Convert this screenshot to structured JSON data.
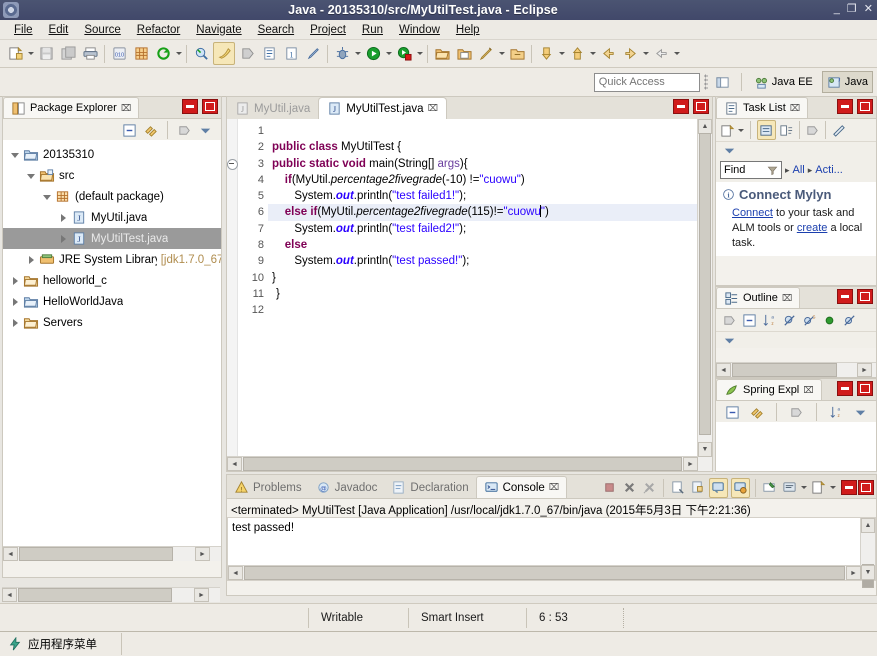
{
  "window": {
    "title": "Java - 20135310/src/MyUtilTest.java - Eclipse",
    "minimize_label": "_",
    "restore_label": "❐",
    "close_label": "✕",
    "app_icon": "eclipse-icon"
  },
  "menu": [
    {
      "label": "File"
    },
    {
      "label": "Edit"
    },
    {
      "label": "Source"
    },
    {
      "label": "Refactor"
    },
    {
      "label": "Navigate"
    },
    {
      "label": "Search"
    },
    {
      "label": "Project"
    },
    {
      "label": "Run"
    },
    {
      "label": "Window"
    },
    {
      "label": "Help"
    }
  ],
  "toolbar": {
    "items": [
      {
        "name": "new-wizard-icon",
        "glyph": "new"
      },
      {
        "name": "new-dropdown-caret",
        "glyph": "caret"
      },
      {
        "name": "save-icon",
        "glyph": "save"
      },
      {
        "name": "save-all-icon",
        "glyph": "saveall"
      },
      {
        "name": "print-icon",
        "glyph": "print"
      },
      {
        "name": "sep",
        "glyph": "sep"
      },
      {
        "name": "build-all-icon",
        "glyph": "build"
      },
      {
        "name": "new-java-package-icon",
        "glyph": "package"
      },
      {
        "name": "refresh-icon",
        "glyph": "refresh"
      },
      {
        "name": "refresh-caret",
        "glyph": "caret"
      },
      {
        "name": "sep",
        "glyph": "sep"
      },
      {
        "name": "open-type-icon",
        "glyph": "opentype"
      },
      {
        "name": "toggle-mark-occurrences-icon",
        "glyph": "marker"
      },
      {
        "name": "skip-breakpoints-icon",
        "glyph": "skipbp"
      },
      {
        "name": "new-java-class-icon",
        "glyph": "javaclass"
      },
      {
        "name": "new-java-interface-icon",
        "glyph": "javainterface"
      },
      {
        "name": "annotation-icon",
        "glyph": "pen"
      },
      {
        "name": "sep",
        "glyph": "sep"
      },
      {
        "name": "debug-icon",
        "glyph": "debug"
      },
      {
        "name": "debug-caret",
        "glyph": "caret"
      },
      {
        "name": "run-icon",
        "glyph": "run"
      },
      {
        "name": "run-caret",
        "glyph": "caret"
      },
      {
        "name": "run-external-tools-icon",
        "glyph": "externaltools"
      },
      {
        "name": "external-tools-caret",
        "glyph": "caret"
      },
      {
        "name": "sep",
        "glyph": "sep"
      },
      {
        "name": "open-resource-icon",
        "glyph": "folder1"
      },
      {
        "name": "open-folder-icon",
        "glyph": "folder2"
      },
      {
        "name": "search-icon",
        "glyph": "pencil"
      },
      {
        "name": "search-caret",
        "glyph": "caret"
      },
      {
        "name": "open-task-icon",
        "glyph": "folder3"
      },
      {
        "name": "sep",
        "glyph": "sep"
      },
      {
        "name": "next-annotation-icon",
        "glyph": "downarrow"
      },
      {
        "name": "next-caret",
        "glyph": "caret"
      },
      {
        "name": "previous-annotation-icon",
        "glyph": "uparrow"
      },
      {
        "name": "prev-caret",
        "glyph": "caret"
      },
      {
        "name": "back-icon",
        "glyph": "back"
      },
      {
        "name": "forward-icon",
        "glyph": "forward"
      },
      {
        "name": "nav-caret",
        "glyph": "caret"
      },
      {
        "name": "last-edit-icon",
        "glyph": "lastedit"
      },
      {
        "name": "lastedit-caret",
        "glyph": "caret"
      }
    ]
  },
  "quick_access": {
    "placeholder": "Quick Access",
    "open_perspective_icon": "open-perspective-icon",
    "perspectives": [
      {
        "label": "Java EE",
        "active": false,
        "icon": "javaee-perspective-icon"
      },
      {
        "label": "Java",
        "active": true,
        "icon": "java-perspective-icon"
      }
    ]
  },
  "package_explorer": {
    "title": "Package Explorer",
    "close_glyph": "⌧",
    "toolbar": [
      {
        "name": "collapse-all-icon"
      },
      {
        "name": "link-with-editor-icon"
      },
      {
        "name": "focus-on-active-task-icon"
      },
      {
        "name": "view-menu-icon"
      }
    ],
    "tree": [
      {
        "label": "20135310",
        "indent": 0,
        "arrow": "open",
        "icon": "project-icon",
        "selected": false
      },
      {
        "label": "src",
        "indent": 1,
        "arrow": "open",
        "icon": "source-folder-icon",
        "selected": false
      },
      {
        "label": "(default package)",
        "indent": 2,
        "arrow": "open",
        "icon": "package-icon",
        "selected": false
      },
      {
        "label": "MyUtil.java",
        "indent": 3,
        "arrow": "closed",
        "icon": "java-file-icon",
        "selected": false
      },
      {
        "label": "MyUtilTest.java",
        "indent": 3,
        "arrow": "closed",
        "icon": "java-file-icon",
        "selected": true
      },
      {
        "label": "JRE System Library",
        "suffix": "[jdk1.7.0_67",
        "indent": 2,
        "arrow": "closed",
        "icon": "library-icon",
        "selected": false
      },
      {
        "label": "helloworld_c",
        "indent": 0,
        "arrow": "closed",
        "icon": "folder-project-icon",
        "selected": false
      },
      {
        "label": "HelloWorldJava",
        "indent": 0,
        "arrow": "closed",
        "icon": "project-closed-icon",
        "selected": false
      },
      {
        "label": "Servers",
        "indent": 0,
        "arrow": "closed",
        "icon": "folder-project-icon",
        "selected": false
      }
    ]
  },
  "editor": {
    "tabs": [
      {
        "label": "MyUtil.java",
        "active": false,
        "icon": "java-file-icon"
      },
      {
        "label": "MyUtilTest.java",
        "active": true,
        "icon": "java-file-icon",
        "close_glyph": "⌧"
      }
    ],
    "lines": [
      {
        "n": "1",
        "fold": false,
        "cur": false,
        "tokens": []
      },
      {
        "n": "2",
        "fold": false,
        "cur": false,
        "tokens": [
          {
            "t": "kw",
            "v": "public class "
          },
          {
            "t": "p",
            "v": "MyUtilTest {"
          }
        ]
      },
      {
        "n": "3",
        "fold": true,
        "cur": false,
        "tokens": [
          {
            "t": "kw",
            "v": "public static void "
          },
          {
            "t": "p",
            "v": "main(String[] "
          },
          {
            "t": "prm",
            "v": "args"
          },
          {
            "t": "p",
            "v": "){"
          }
        ]
      },
      {
        "n": "4",
        "fold": false,
        "cur": false,
        "tokens": [
          {
            "t": "p",
            "v": "    "
          },
          {
            "t": "kw",
            "v": "if"
          },
          {
            "t": "p",
            "v": "(MyUtil."
          },
          {
            "t": "stm",
            "v": "percentage2fivegrade"
          },
          {
            "t": "p",
            "v": "(-10) !="
          },
          {
            "t": "str",
            "v": "\"cuowu\""
          },
          {
            "t": "p",
            "v": ")"
          }
        ]
      },
      {
        "n": "5",
        "fold": false,
        "cur": false,
        "tokens": [
          {
            "t": "p",
            "v": "       System."
          },
          {
            "t": "fld",
            "v": "out"
          },
          {
            "t": "p",
            "v": ".println("
          },
          {
            "t": "str",
            "v": "\"test failed1!\""
          },
          {
            "t": "p",
            "v": ");"
          }
        ]
      },
      {
        "n": "6",
        "fold": false,
        "cur": true,
        "tokens": [
          {
            "t": "p",
            "v": "    "
          },
          {
            "t": "kw",
            "v": "else if"
          },
          {
            "t": "p",
            "v": "(MyUtil."
          },
          {
            "t": "stm",
            "v": "percentage2fivegrade"
          },
          {
            "t": "p",
            "v": "(115)!="
          },
          {
            "t": "str",
            "v": "\"cuowu"
          },
          {
            "t": "caret",
            "v": ""
          },
          {
            "t": "str",
            "v": "\""
          },
          {
            "t": "p",
            "v": ")"
          }
        ]
      },
      {
        "n": "7",
        "fold": false,
        "cur": false,
        "tokens": [
          {
            "t": "p",
            "v": "       System."
          },
          {
            "t": "fld",
            "v": "out"
          },
          {
            "t": "p",
            "v": ".println("
          },
          {
            "t": "str",
            "v": "\"test failed2!\""
          },
          {
            "t": "p",
            "v": ");"
          }
        ]
      },
      {
        "n": "8",
        "fold": false,
        "cur": false,
        "tokens": [
          {
            "t": "p",
            "v": "    "
          },
          {
            "t": "kw",
            "v": "else"
          }
        ]
      },
      {
        "n": "9",
        "fold": false,
        "cur": false,
        "tokens": [
          {
            "t": "p",
            "v": "       System."
          },
          {
            "t": "fld",
            "v": "out"
          },
          {
            "t": "p",
            "v": ".println("
          },
          {
            "t": "str",
            "v": "\"test passed!\""
          },
          {
            "t": "p",
            "v": ");"
          }
        ]
      },
      {
        "n": "10",
        "fold": false,
        "cur": false,
        "tokens": [
          {
            "t": "p",
            "v": "}"
          }
        ]
      },
      {
        "n": "11",
        "fold": false,
        "cur": false,
        "tokens": [
          {
            "t": "p",
            "v": "}"
          }
        ]
      },
      {
        "n": "12",
        "fold": false,
        "cur": false,
        "tokens": []
      }
    ]
  },
  "task_list": {
    "title": "Task List",
    "close_glyph": "⌧",
    "toolbar": [
      {
        "name": "new-task-icon"
      },
      {
        "name": "new-task-caret"
      },
      {
        "name": "categorized-presentation-icon"
      },
      {
        "name": "scheduled-presentation-icon"
      },
      {
        "name": "focus-on-workweek-icon"
      },
      {
        "name": "synchronize-changed-icon"
      },
      {
        "name": "view-menu-icon"
      }
    ],
    "find_placeholder": "Find",
    "find_icon": "filter-icon",
    "filters": [
      {
        "label": "All"
      },
      {
        "label": "Acti..."
      }
    ],
    "mylyn": {
      "heading": "Connect Mylyn",
      "info_icon": "info-icon",
      "body_prefix": "Connect",
      "body_mid": " to your task and ALM tools or ",
      "body_link2": "create",
      "body_suffix": " a local task."
    }
  },
  "outline": {
    "title": "Outline",
    "close_glyph": "⌧",
    "toolbar": [
      {
        "name": "focus-on-active-task-icon"
      },
      {
        "name": "collapse-all-icon"
      },
      {
        "name": "sort-icon"
      },
      {
        "name": "hide-fields-icon"
      },
      {
        "name": "hide-static-icon"
      },
      {
        "name": "hide-non-public-icon"
      },
      {
        "name": "hide-local-types-icon"
      },
      {
        "name": "view-menu-icon"
      }
    ]
  },
  "spring_explorer": {
    "title": "Spring Expl",
    "close_glyph": "⌧",
    "toolbar": [
      {
        "name": "collapse-all-icon"
      },
      {
        "name": "link-with-editor-icon"
      },
      {
        "name": "focus-on-active-task-icon"
      },
      {
        "name": "sort-icon"
      },
      {
        "name": "view-menu-icon"
      }
    ]
  },
  "console": {
    "tabs": [
      {
        "label": "Problems",
        "active": false,
        "icon": "problems-icon"
      },
      {
        "label": "Javadoc",
        "active": false,
        "icon": "javadoc-icon"
      },
      {
        "label": "Declaration",
        "active": false,
        "icon": "declaration-icon"
      },
      {
        "label": "Console",
        "active": true,
        "icon": "console-icon",
        "close_glyph": "⌧"
      }
    ],
    "toolbar": [
      {
        "name": "terminate-icon"
      },
      {
        "name": "remove-launch-icon"
      },
      {
        "name": "remove-all-terminated-icon"
      },
      {
        "name": "clear-console-icon"
      },
      {
        "name": "lock-scroll-icon"
      },
      {
        "name": "scroll-lock-icon"
      },
      {
        "name": "show-console-on-output-icon"
      },
      {
        "name": "pin-console-icon"
      },
      {
        "name": "display-selected-console-icon"
      },
      {
        "name": "display-console-caret"
      },
      {
        "name": "open-console-icon"
      },
      {
        "name": "open-console-caret"
      }
    ],
    "launch_line": "<terminated> MyUtilTest [Java Application] /usr/local/jdk1.7.0_67/bin/java (2015年5月3日 下午2:21:36)",
    "output": "test passed!"
  },
  "status_bar": {
    "writable": "Writable",
    "insert_mode": "Smart Insert",
    "position": "6 : 53"
  },
  "taskbar": {
    "menu_label": "应用程序菜单",
    "menu_icon": "lightning-icon"
  },
  "colors": {
    "titlebar": "#464e6e",
    "keyword": "#7f0055",
    "string": "#2a00ff",
    "selection": "#9a9a9a",
    "accent_red": "#d01b1b",
    "link": "#1b3fae",
    "current_line": "#eaeef8"
  }
}
